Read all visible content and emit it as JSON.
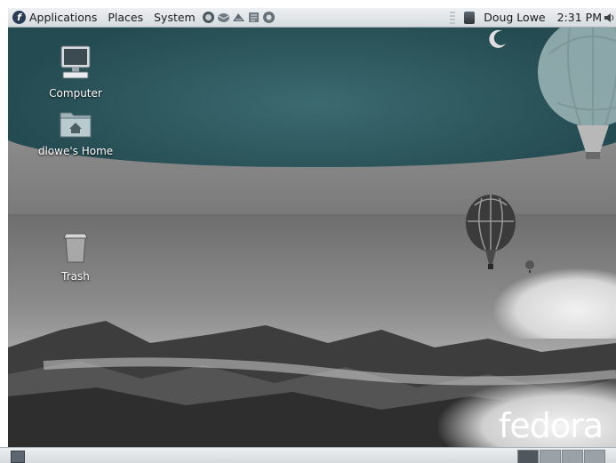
{
  "top_panel": {
    "menus": [
      {
        "label": "Applications"
      },
      {
        "label": "Places"
      },
      {
        "label": "System"
      }
    ],
    "launchers": [
      "web-browser-icon",
      "mail-icon",
      "network-icon",
      "text-editor-icon",
      "help-icon"
    ],
    "user": "Doug Lowe",
    "clock": "2:31 PM"
  },
  "desktop": {
    "icons": [
      {
        "label": "Computer",
        "icon": "computer-icon"
      },
      {
        "label": "dlowe's Home",
        "icon": "home-folder-icon"
      },
      {
        "label": "Trash",
        "icon": "trash-icon"
      }
    ],
    "wallpaper_brand": "fedora"
  },
  "bottom_panel": {
    "workspaces": 4,
    "active_workspace": 1
  }
}
